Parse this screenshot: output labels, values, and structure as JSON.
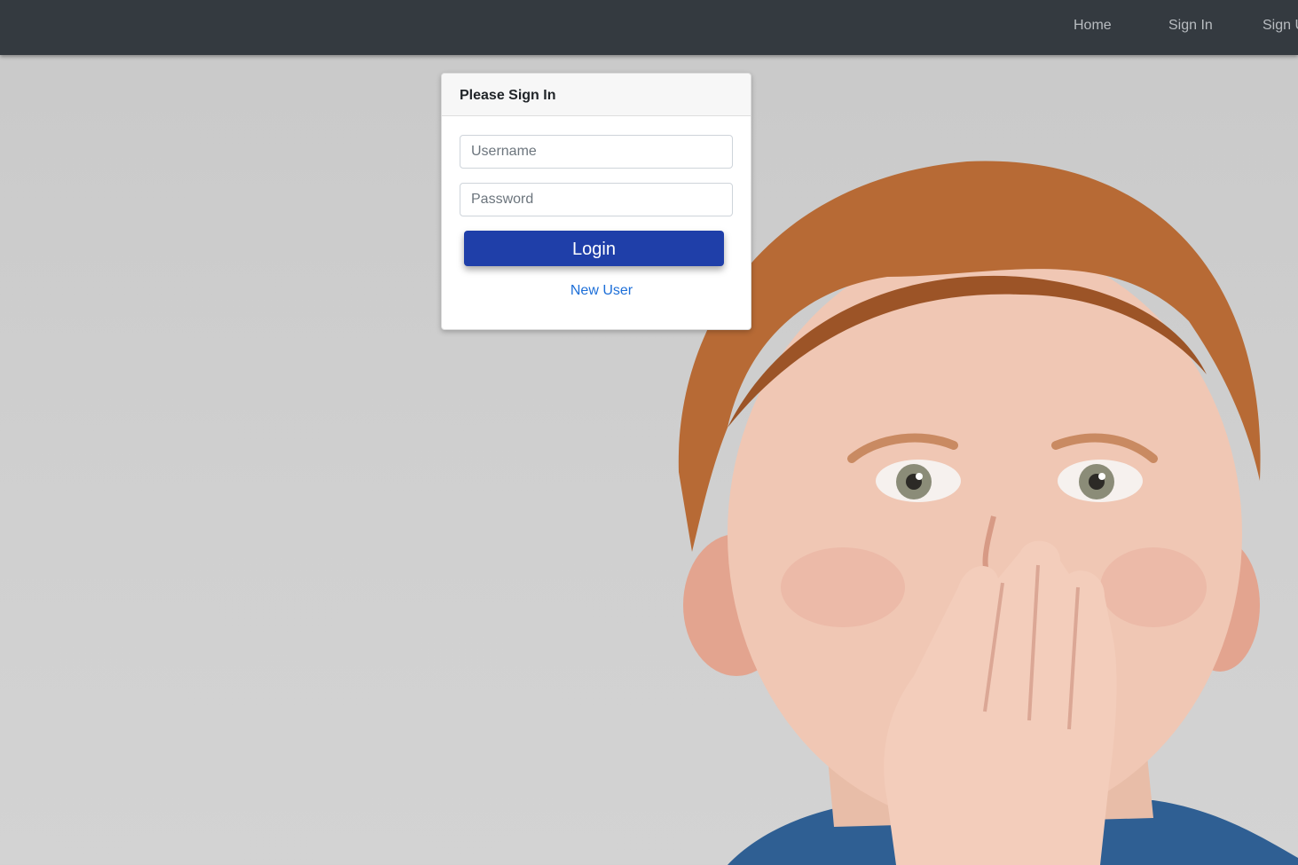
{
  "nav": {
    "items": [
      {
        "label": "Home"
      },
      {
        "label": "Sign In"
      },
      {
        "label": "Sign Up"
      }
    ]
  },
  "login_card": {
    "title": "Please Sign In",
    "username_placeholder": "Username",
    "password_placeholder": "Password",
    "login_label": "Login",
    "new_user_label": "New User"
  },
  "colors": {
    "navbar": "#343a40",
    "login_button": "#1f3fa9",
    "link": "#1d6fd8"
  }
}
